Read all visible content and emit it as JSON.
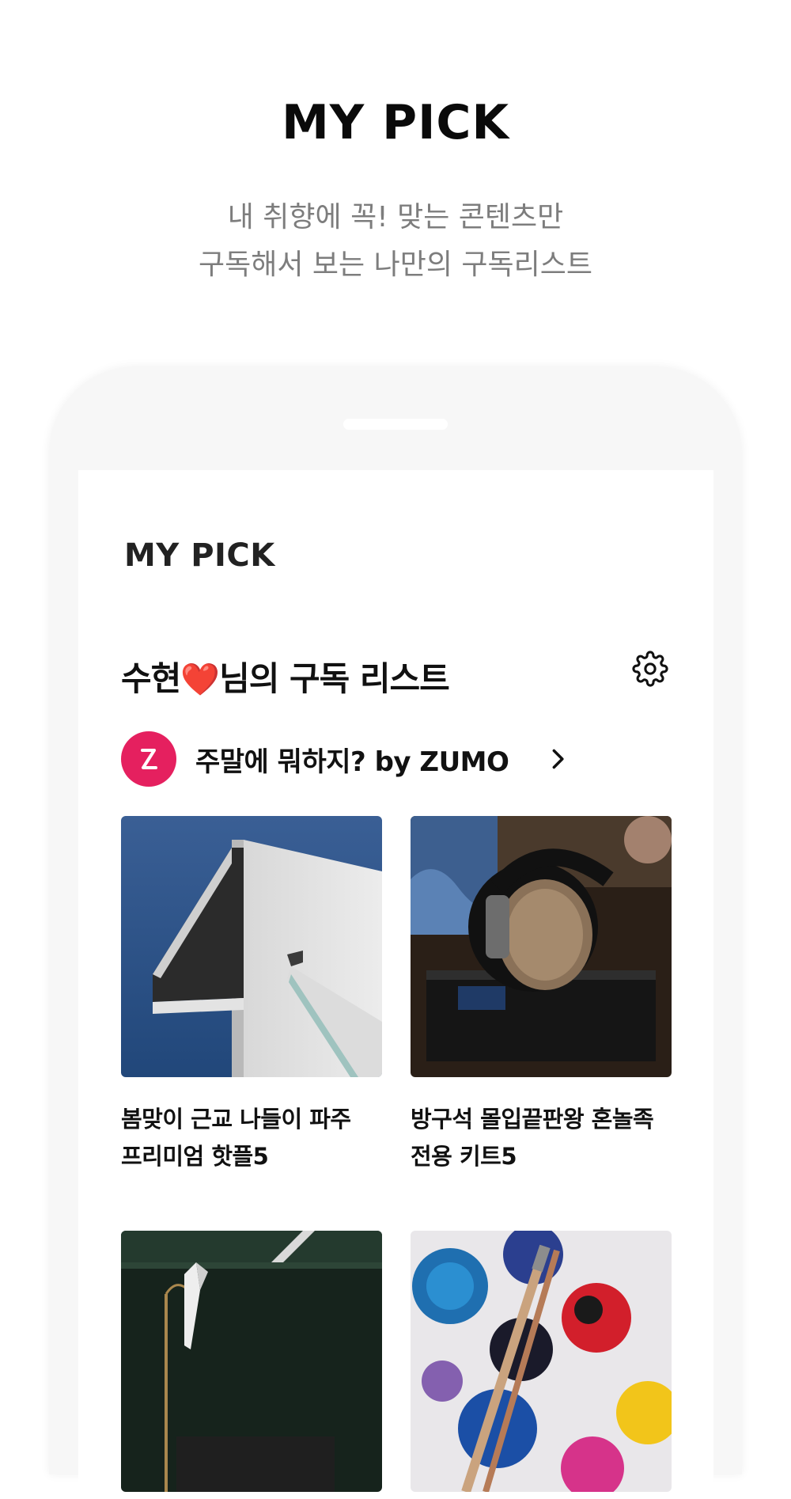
{
  "hero": {
    "title": "MY PICK",
    "subtitle_line1": "내 취향에 꼭! 맞는 콘텐츠만",
    "subtitle_line2": "구독해서 보는 나만의 구독리스트"
  },
  "app": {
    "title": "MY PICK",
    "list_title_prefix": "수현",
    "list_title_heart": "❤️",
    "list_title_suffix": "님의 구독 리스트",
    "settings_icon": "gear-icon"
  },
  "channel": {
    "name": "주말에 뭐하지? by ZUMO",
    "logo_color": "#e5205f",
    "arrow_icon": "chevron-right-icon"
  },
  "cards": [
    {
      "title_line1": "봄맞이 근교 나들이 파주",
      "title_line2": "프리미엄 핫플5"
    },
    {
      "title_line1": "방구석 몰입끝판왕 혼놀족",
      "title_line2": "전용 키트5"
    },
    {
      "title_line1": "",
      "title_line2": ""
    },
    {
      "title_line1": "",
      "title_line2": ""
    }
  ],
  "colors": {
    "accent": "#e5205f",
    "heart": "#e8212d",
    "subtitle": "#7d7d7d"
  }
}
